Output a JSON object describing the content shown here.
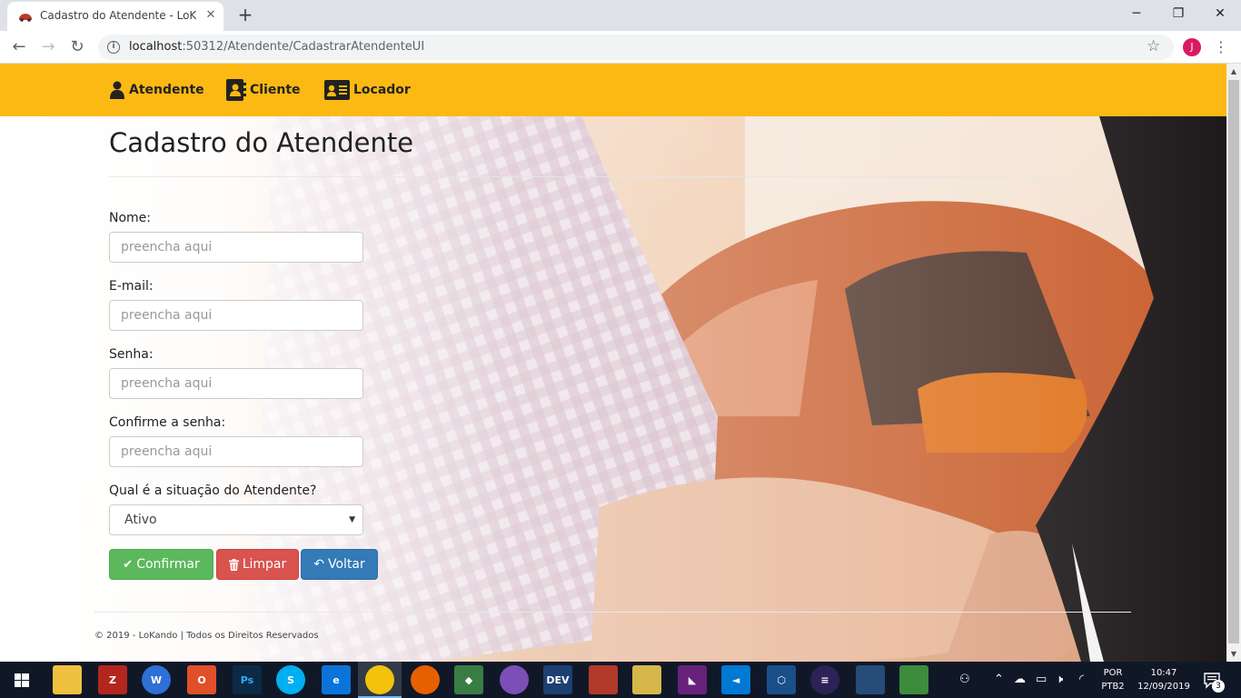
{
  "browser": {
    "tab_title": "Cadastro do Atendente - LoKando",
    "url_host": "localhost",
    "url_path": ":50312/Atendente/CadastrarAtendenteUI",
    "profile_initial": "J",
    "icons": [
      "back-icon",
      "forward-icon",
      "reload-icon",
      "info-icon",
      "star-icon",
      "menu-icon",
      "close-icon",
      "plus-icon",
      "minimize-icon",
      "maximize-icon"
    ]
  },
  "navbar": {
    "color": "#fdb913",
    "items": [
      {
        "label": "Atendente",
        "icon": "user-icon"
      },
      {
        "label": "Cliente",
        "icon": "address-book-icon"
      },
      {
        "label": "Locador",
        "icon": "id-card-icon"
      }
    ]
  },
  "form": {
    "title": "Cadastro do Atendente",
    "fields": [
      {
        "label": "Nome:",
        "placeholder": "preencha aqui",
        "value": ""
      },
      {
        "label": "E-mail:",
        "placeholder": "preencha aqui",
        "value": ""
      },
      {
        "label": "Senha:",
        "placeholder": "preencha aqui",
        "value": ""
      },
      {
        "label": "Confirme a senha:",
        "placeholder": "preencha aqui",
        "value": ""
      }
    ],
    "status": {
      "label": "Qual é a situação do Atendente?",
      "selected": "Ativo"
    },
    "buttons": {
      "confirm": "Confirmar",
      "clear": "Limpar",
      "back": "Voltar"
    },
    "colors": {
      "confirm": "#5cb85c",
      "clear": "#d9534f",
      "back": "#337ab7"
    }
  },
  "footer": {
    "text": "© 2019 - LoKando | Todos os Direitos Reservados"
  },
  "taskbar": {
    "apps": [
      "file-explorer",
      "filezilla",
      "wps-writer",
      "office",
      "photoshop",
      "skype",
      "edge",
      "chrome",
      "firefox",
      "git",
      "app",
      "devexpress",
      "app",
      "app",
      "visual-studio",
      "vs-code",
      "virtualbox",
      "eclipse",
      "sql-server",
      "app"
    ],
    "language": "POR",
    "keyboard": "PTB2",
    "time": "10:47",
    "date": "12/09/2019",
    "notifications": "3"
  }
}
